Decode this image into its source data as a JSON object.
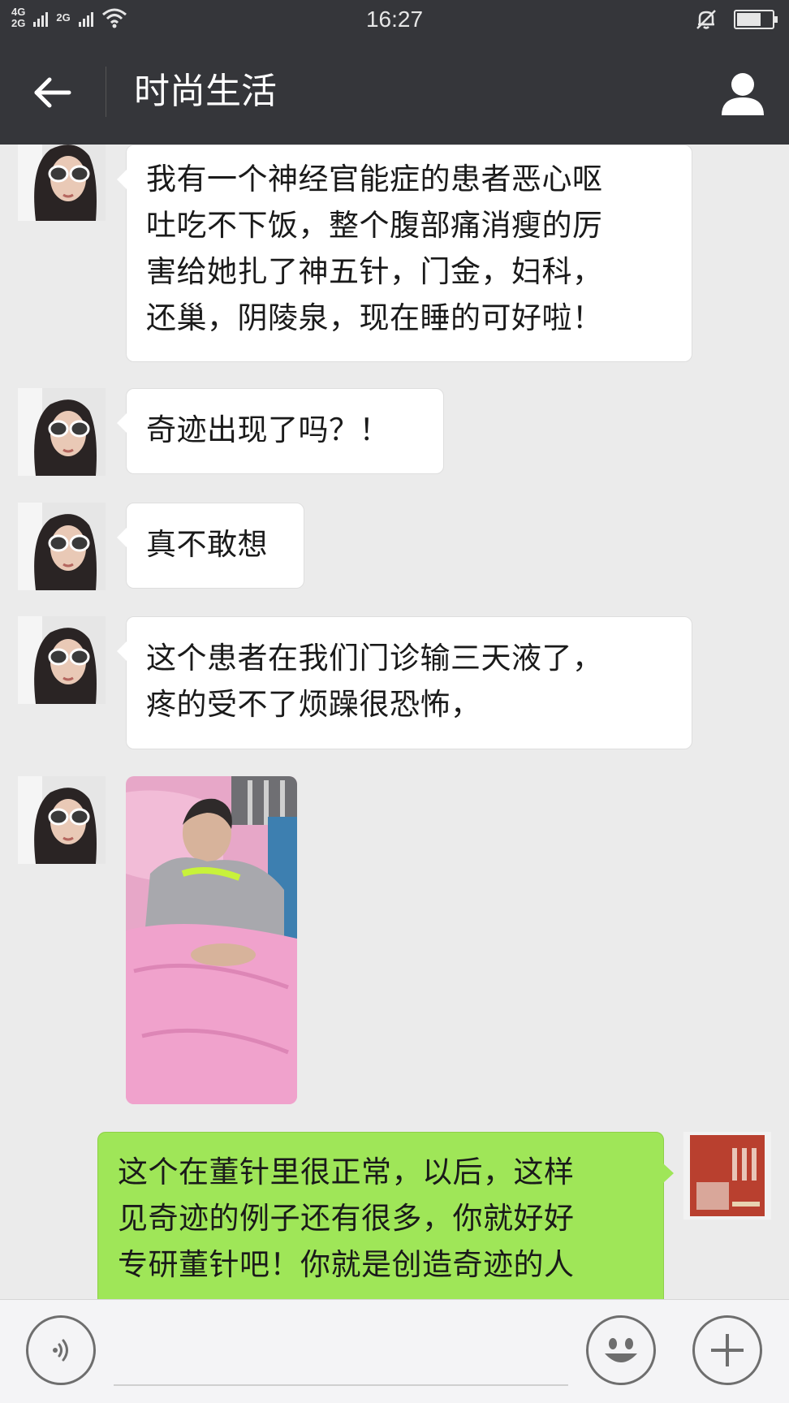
{
  "status_bar": {
    "network_top": "4G",
    "network_bottom": "2G",
    "network2": "2G",
    "time": "16:27",
    "battery_level": 0.7
  },
  "header": {
    "title": "时尚生活",
    "back_icon": "back-arrow-icon",
    "profile_icon": "person-icon"
  },
  "messages": [
    {
      "from": "other",
      "lines": [
        "我有一个神经官能症的患者恶心呕",
        "吐吃不下饭，整个腹部痛消瘦的厉",
        "害给她扎了神五针，门金，妇科，",
        "还巢，阴陵泉，现在睡的可好啦！"
      ]
    },
    {
      "from": "other",
      "lines": [
        "奇迹出现了吗？！"
      ]
    },
    {
      "from": "other",
      "lines": [
        "真不敢想"
      ]
    },
    {
      "from": "other",
      "lines": [
        "这个患者在我们门诊输三天液了，",
        "疼的受不了烦躁很恐怖，"
      ]
    },
    {
      "from": "other",
      "type": "image"
    },
    {
      "from": "me",
      "lines": [
        "这个在董针里很正常，以后，这样",
        "见奇迹的例子还有很多，你就好好",
        "专研董针吧！你就是创造奇迹的人"
      ]
    }
  ],
  "input_bar": {
    "voice_icon": "voice-icon",
    "emoji_icon": "emoji-icon",
    "plus_icon": "plus-icon"
  },
  "colors": {
    "header_bg": "#35363a",
    "chat_bg": "#ebebeb",
    "incoming_bubble": "#ffffff",
    "outgoing_bubble": "#9fe658"
  }
}
